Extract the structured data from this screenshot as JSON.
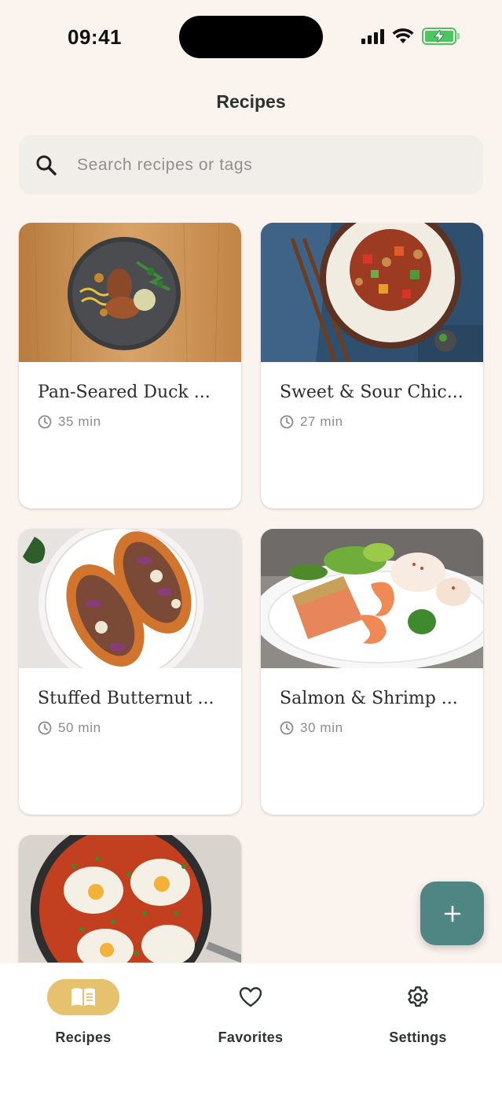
{
  "status_bar": {
    "time": "09:41"
  },
  "header": {
    "title": "Recipes"
  },
  "search": {
    "placeholder": "Search recipes or tags"
  },
  "recipes": [
    {
      "title": "Pan-Seared Duck ...",
      "time": "35 min"
    },
    {
      "title": "Sweet & Sour Chic...",
      "time": "27 min"
    },
    {
      "title": "Stuffed Butternut ...",
      "time": "50 min"
    },
    {
      "title": "Salmon & Shrimp ...",
      "time": "30 min"
    }
  ],
  "nav": {
    "items": [
      {
        "label": "Recipes",
        "icon": "book-icon",
        "active": true
      },
      {
        "label": "Favorites",
        "icon": "heart-icon",
        "active": false
      },
      {
        "label": "Settings",
        "icon": "gear-icon",
        "active": false
      }
    ]
  },
  "colors": {
    "background": "#FBF3EE",
    "accent": "#E6C26E",
    "fab": "#4F8582"
  }
}
